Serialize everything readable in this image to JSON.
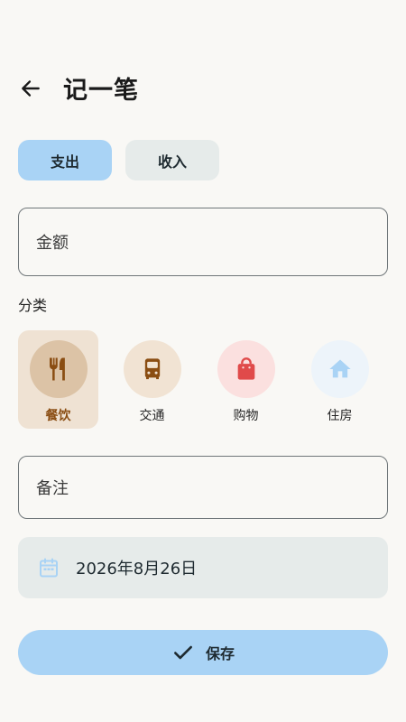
{
  "header": {
    "title": "记一笔",
    "back_icon": "arrow-left-icon"
  },
  "type_toggle": {
    "selected": "expense",
    "expense_label": "支出",
    "income_label": "收入"
  },
  "amount": {
    "placeholder": "金额",
    "value": ""
  },
  "category": {
    "section_label": "分类",
    "items": [
      {
        "id": "dining",
        "label": "餐饮",
        "icon": "fork-knife-icon",
        "selected": true,
        "icon_color": "#8a4d12",
        "circle_color": "#dcc3a6"
      },
      {
        "id": "transport",
        "label": "交通",
        "icon": "bus-icon",
        "selected": false,
        "icon_color": "#8a4d12",
        "circle_color": "#f1e3d3"
      },
      {
        "id": "shopping",
        "label": "购物",
        "icon": "shopping-bag-icon",
        "selected": false,
        "icon_color": "#e04a4a",
        "circle_color": "#fbe0df"
      },
      {
        "id": "housing",
        "label": "住房",
        "icon": "house-icon",
        "selected": false,
        "icon_color": "#a9d3f5",
        "circle_color": "#edf4fa"
      }
    ]
  },
  "note": {
    "placeholder": "备注",
    "value": ""
  },
  "date": {
    "icon": "calendar-icon",
    "value": "2026年8月26日"
  },
  "save": {
    "label": "保存",
    "icon": "check-icon"
  },
  "colors": {
    "background": "#f9f8f5",
    "accent": "#a9d3f5",
    "surface": "#e6ebea",
    "dining_brown": "#8a4d12",
    "shopping_red": "#e04a4a"
  }
}
